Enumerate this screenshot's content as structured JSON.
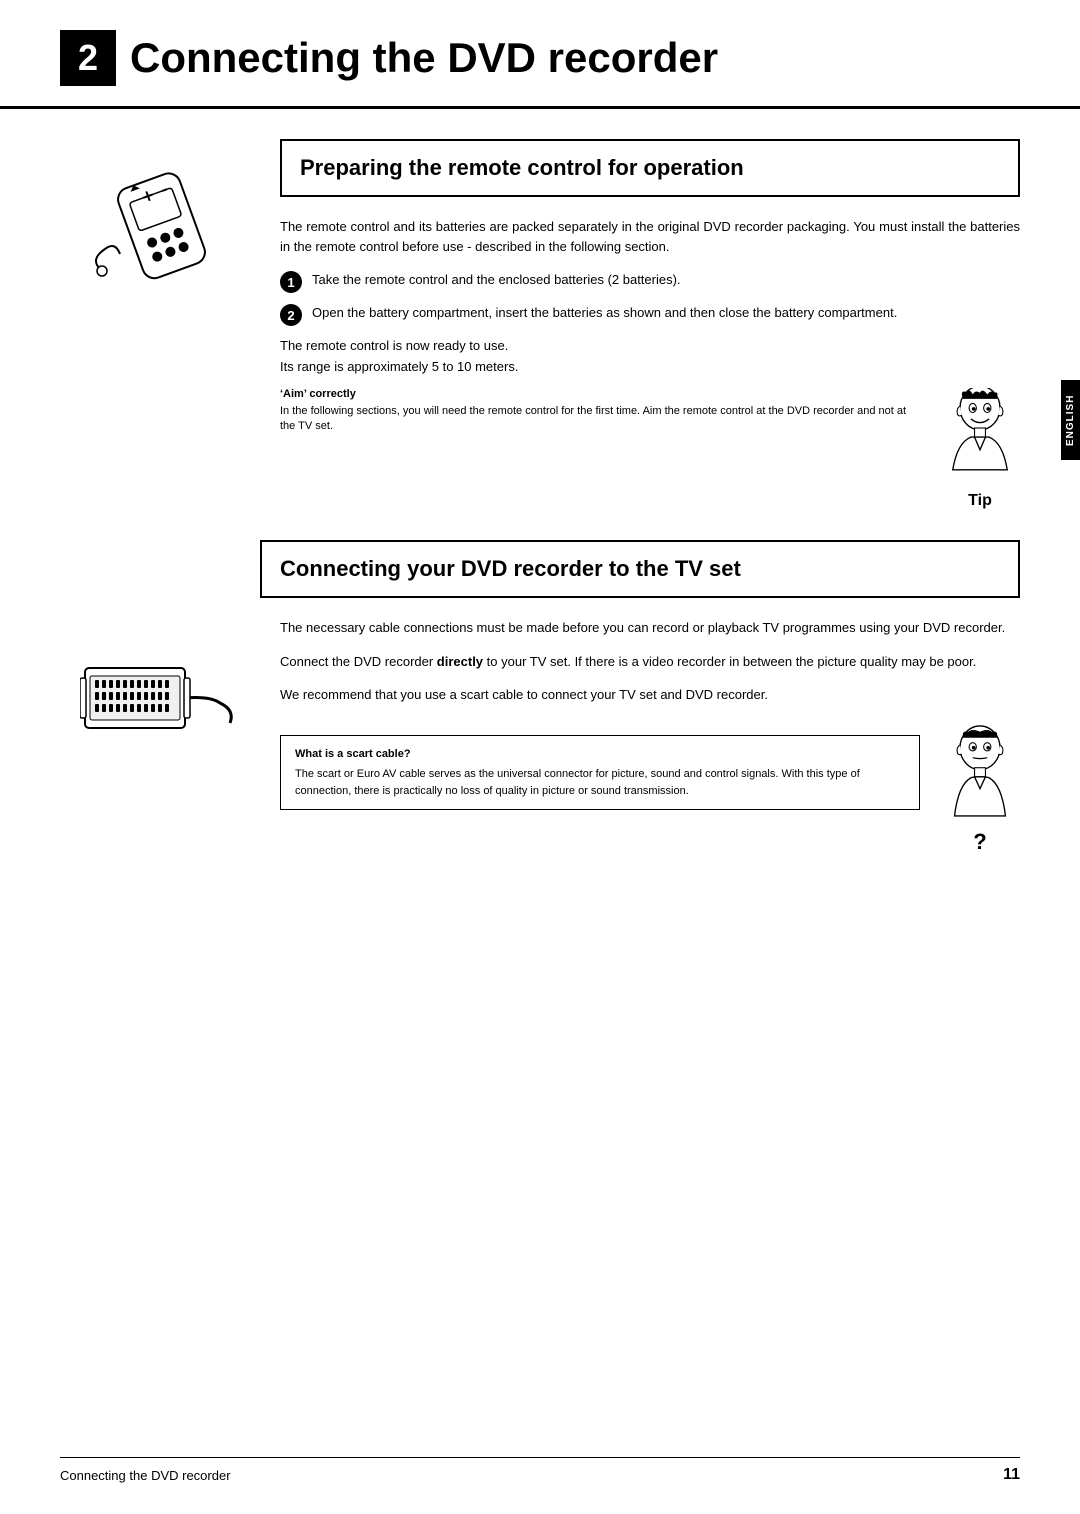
{
  "header": {
    "chapter_number": "2",
    "title": "Connecting the DVD recorder"
  },
  "section1": {
    "box_title": "Preparing the remote control for operation",
    "intro_text": "The remote control and its batteries are packed separately in the original DVD recorder packaging. You must install the batteries in the remote control before use - described in the following section.",
    "steps": [
      {
        "number": "1",
        "text": "Take the remote control and the enclosed batteries (2 batteries)."
      },
      {
        "number": "2",
        "text": "Open the battery compartment, insert the batteries as shown and then close the battery compartment."
      }
    ],
    "ready_line1": "The remote control is now ready to use.",
    "ready_line2": "Its range is approximately 5 to 10 meters.",
    "tip_title": "‘Aim’ correctly",
    "tip_text": "In the following sections, you will need the remote control for the first time. Aim the remote control at the DVD recorder and not at the TV set.",
    "tip_label": "Tip"
  },
  "section2": {
    "box_title": "Connecting your DVD recorder to the TV set",
    "para1": "The necessary cable connections must be made before you can record or playback TV programmes using your DVD recorder.",
    "para2_prefix": "Connect the DVD recorder ",
    "para2_bold": "directly",
    "para2_suffix": " to your TV set. If there is a video recorder in between the picture quality may be poor.",
    "para3": "We recommend that you use a scart cable to connect your TV set and DVD recorder.",
    "info_box_title": "What is a scart cable?",
    "info_box_text": "The scart or Euro AV cable serves as the universal connector for picture, sound and control signals. With this type of connection, there is practically no loss of quality in picture or sound transmission.",
    "question_label": "?"
  },
  "sidebar": {
    "label": "ENGLISH"
  },
  "footer": {
    "text": "Connecting the DVD recorder",
    "page": "11"
  }
}
